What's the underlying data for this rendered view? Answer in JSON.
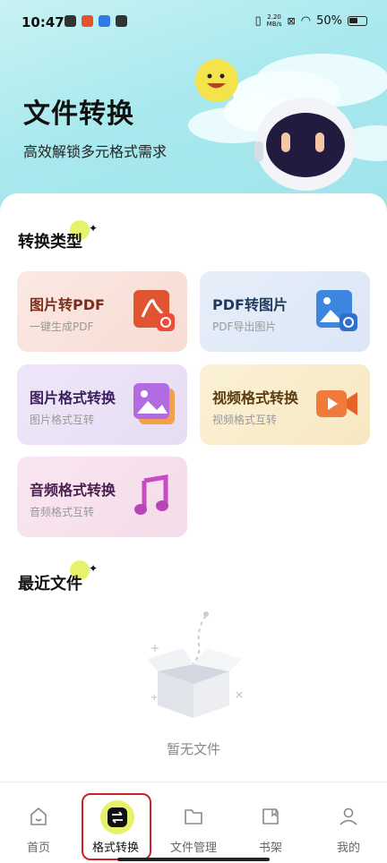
{
  "status_bar": {
    "time": "10:47",
    "net_speed_value": "2.20",
    "net_speed_unit": "MB/s",
    "battery": "50%"
  },
  "hero": {
    "title": "文件转换",
    "subtitle": "高效解锁多元格式需求"
  },
  "sections": {
    "conversion_types": "转换类型",
    "recent_files": "最近文件"
  },
  "cards": [
    {
      "title": "图片转PDF",
      "subtitle": "一键生成PDF",
      "icon": "pdf-icon"
    },
    {
      "title": "PDF转图片",
      "subtitle": "PDF导出图片",
      "icon": "image-icon"
    },
    {
      "title": "图片格式转换",
      "subtitle": "图片格式互转",
      "icon": "photo-icon"
    },
    {
      "title": "视频格式转换",
      "subtitle": "视频格式互转",
      "icon": "video-camera-icon"
    },
    {
      "title": "音频格式转换",
      "subtitle": "音频格式互转",
      "icon": "music-note-icon"
    }
  ],
  "recent": {
    "empty_text": "暂无文件"
  },
  "tabbar": {
    "items": [
      {
        "label": "首页",
        "icon": "home-icon"
      },
      {
        "label": "格式转换",
        "icon": "convert-icon",
        "active": true
      },
      {
        "label": "文件管理",
        "icon": "folder-icon"
      },
      {
        "label": "书架",
        "icon": "bookshelf-icon"
      },
      {
        "label": "我的",
        "icon": "profile-icon"
      }
    ]
  },
  "colors": {
    "hero_bg": "#aee9ee",
    "accent_yellow": "#e6f26a",
    "active_tab_bg": "#e6f26a",
    "highlight_red": "#d11f25",
    "card1_title": "#7a2f1e",
    "card2_title": "#1f3a5c",
    "card3_title": "#3b1f5c",
    "card4_title": "#5c3b12",
    "card5_title": "#4a1f4f"
  }
}
